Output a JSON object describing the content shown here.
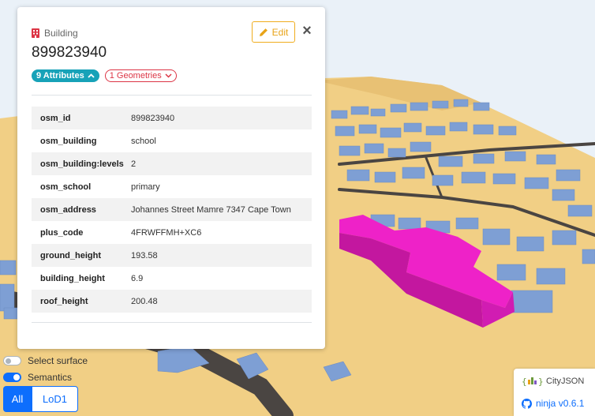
{
  "scene": {
    "colors": {
      "sky": "#eaf1f8",
      "terrain": "#f1cf85",
      "building": "#7e9fd4",
      "selected": "#ee22c8",
      "road": "#4a4542"
    }
  },
  "panel": {
    "type_icon": "building-icon",
    "type_label": "Building",
    "object_id": "899823940",
    "edit_label": "Edit",
    "close_glyph": "×",
    "attributes_badge": "9 Attributes",
    "geometries_badge": "1 Geometries",
    "attributes": [
      {
        "key": "osm_id",
        "value": "899823940"
      },
      {
        "key": "osm_building",
        "value": "school"
      },
      {
        "key": "osm_building:levels",
        "value": "2"
      },
      {
        "key": "osm_school",
        "value": "primary"
      },
      {
        "key": "osm_address",
        "value": "Johannes Street Mamre 7347 Cape Town"
      },
      {
        "key": "plus_code",
        "value": "4FRWFFMH+XC6"
      },
      {
        "key": "ground_height",
        "value": "193.58"
      },
      {
        "key": "building_height",
        "value": "6.9"
      },
      {
        "key": "roof_height",
        "value": "200.48"
      }
    ]
  },
  "controls": {
    "select_surface": {
      "label": "Select surface",
      "checked": false
    },
    "semantics": {
      "label": "Semantics",
      "checked": true
    },
    "lod_buttons": [
      "All",
      "LoD1"
    ],
    "active_lod": "All"
  },
  "footer": {
    "cityjson_label": "CityJSON",
    "ninja_label": "ninja v0.6.1"
  }
}
